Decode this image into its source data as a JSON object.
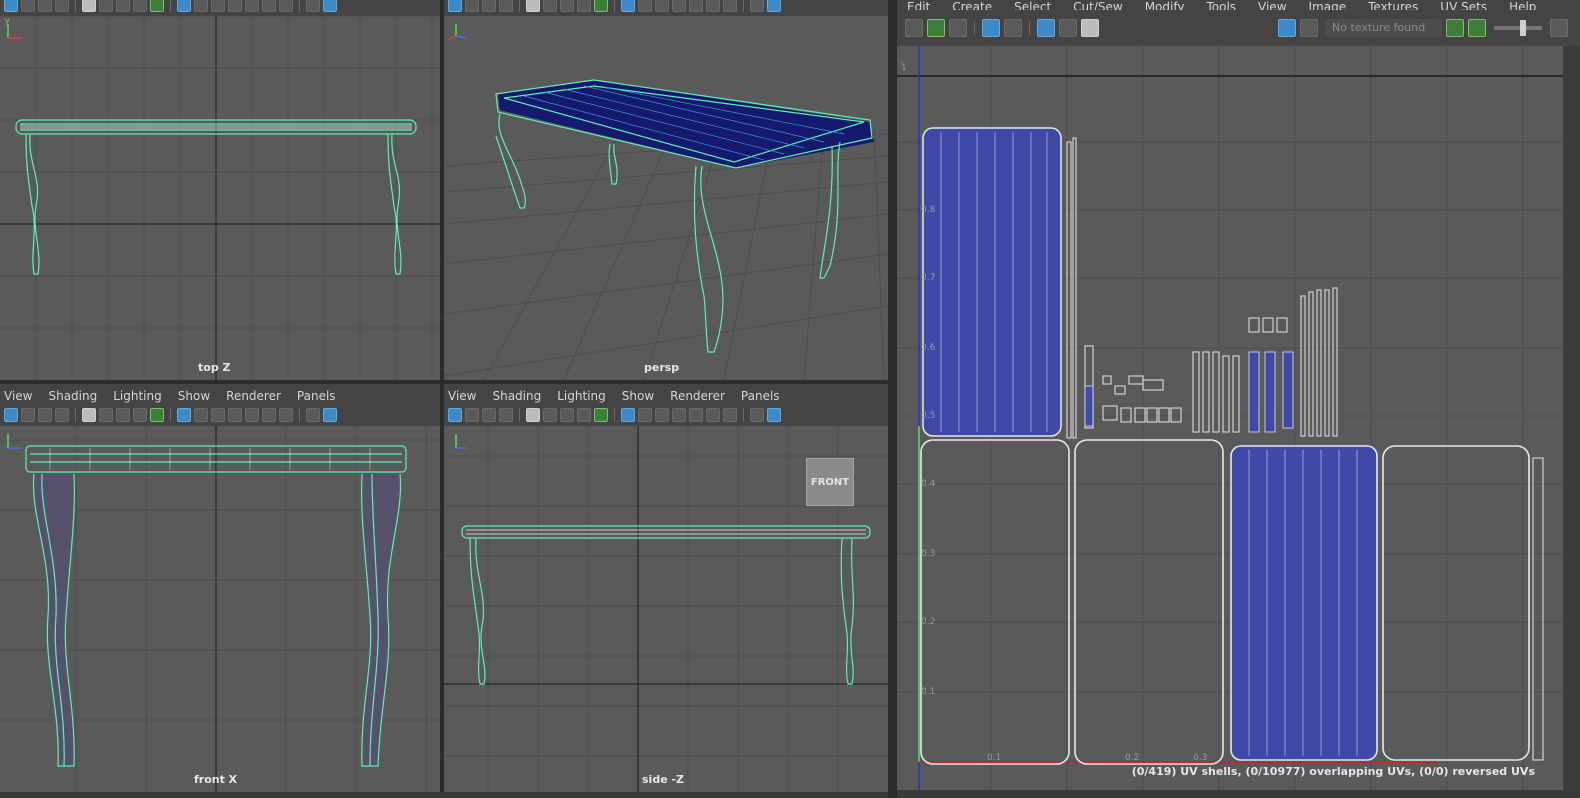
{
  "viewport_menu": {
    "items": [
      "View",
      "Shading",
      "Lighting",
      "Show",
      "Renderer",
      "Panels"
    ]
  },
  "viewports": {
    "top": {
      "label": "top Z"
    },
    "persp": {
      "label": "persp"
    },
    "front": {
      "label": "front X"
    },
    "side": {
      "label": "side -Z"
    }
  },
  "viewcube": {
    "face": "FRONT"
  },
  "uv_editor": {
    "menu": [
      "Edit",
      "Create",
      "Select",
      "Cut/Sew",
      "Modify",
      "Tools",
      "View",
      "Image",
      "Textures",
      "UV Sets",
      "Help"
    ],
    "texture_placeholder": "No texture found",
    "ticks_v": [
      "0.8",
      "0.7",
      "0.6",
      "0.5",
      "0.4",
      "0.3",
      "0.2",
      "0.1"
    ],
    "ticks_u": [
      "0.1",
      "0.2",
      "0.3"
    ],
    "status": "(0/419) UV shells, (0/10977) overlapping UVs, (0/0) reversed UVs"
  },
  "colors": {
    "wire": "#5ef0b4",
    "shell_fill": "#3f4aa8",
    "uv_outline": "#e8e8e8",
    "viewport_bg": "#5a5a5a",
    "grid": "#4c4c4c"
  },
  "icons": [
    "select-icon",
    "lasso-icon",
    "camera-icon",
    "grid-icon",
    "wireframe-icon",
    "shaded-icon",
    "texture-icon",
    "isolate-icon"
  ]
}
